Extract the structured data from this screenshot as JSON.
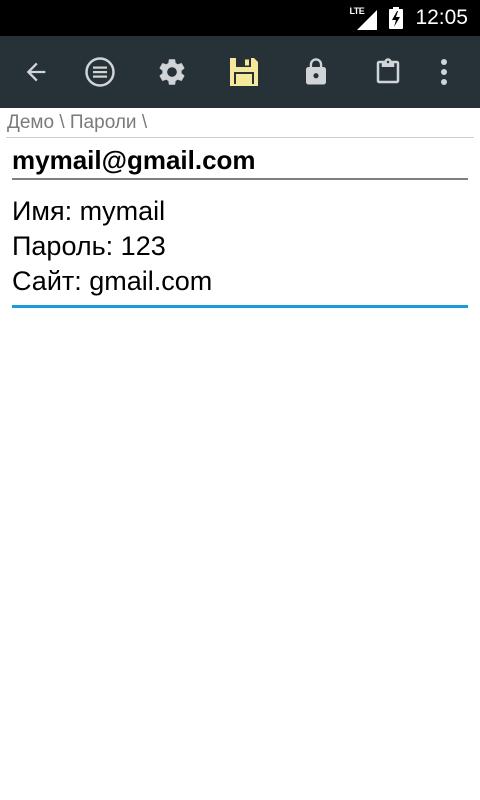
{
  "status_bar": {
    "network_label": "LTE",
    "time": "12:05"
  },
  "toolbar": {
    "icons": [
      "back-arrow-icon",
      "menu-circle-icon",
      "gear-icon",
      "save-icon",
      "lock-icon",
      "clipboard-icon",
      "overflow-menu-icon"
    ],
    "save_icon_color": "#f6e89a",
    "icon_color": "#d0d4d6",
    "background": "#263238"
  },
  "breadcrumb": {
    "path": "Демо \\ Пароли \\"
  },
  "entry": {
    "title": "mymail@gmail.com",
    "body_lines": [
      "Имя: mymail",
      "Пароль: 123",
      "Сайт: gmail.com"
    ],
    "focus_underline_color": "#1a9ad6"
  }
}
